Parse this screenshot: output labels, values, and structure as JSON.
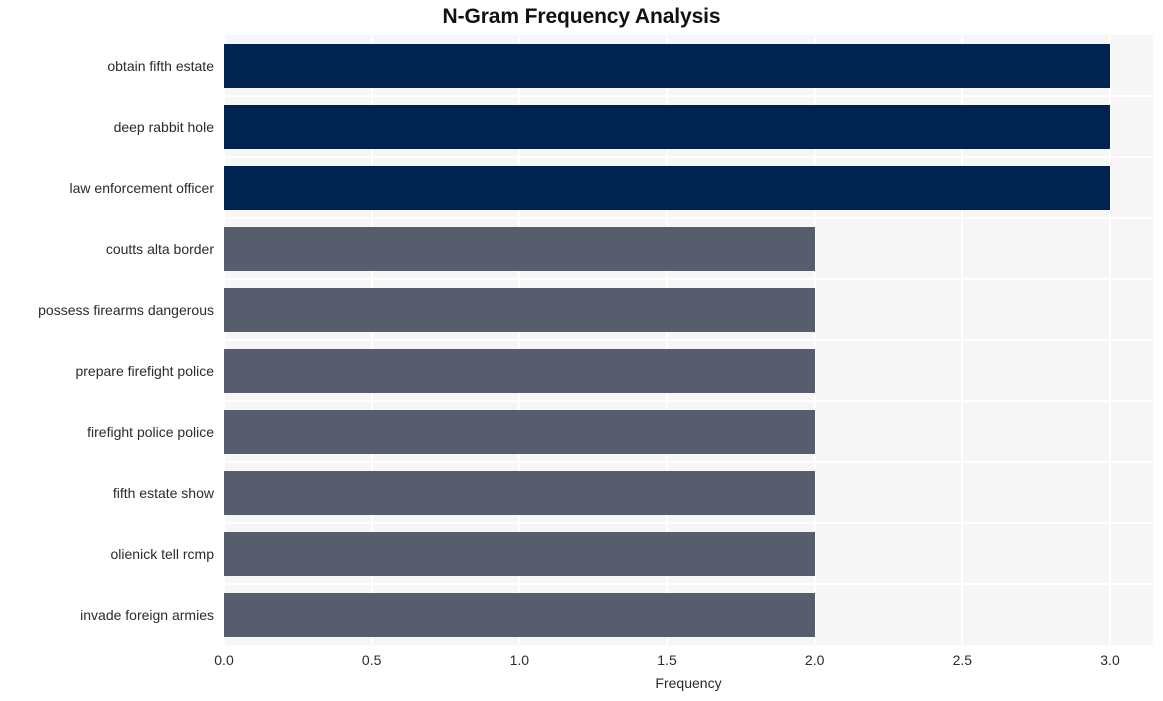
{
  "chart_data": {
    "type": "bar",
    "orientation": "horizontal",
    "title": "N-Gram Frequency Analysis",
    "xlabel": "Frequency",
    "ylabel": "",
    "categories": [
      "obtain fifth estate",
      "deep rabbit hole",
      "law enforcement officer",
      "coutts alta border",
      "possess firearms dangerous",
      "prepare firefight police",
      "firefight police police",
      "fifth estate show",
      "olienick tell rcmp",
      "invade foreign armies"
    ],
    "values": [
      3,
      3,
      3,
      2,
      2,
      2,
      2,
      2,
      2,
      2
    ],
    "xlim": [
      0,
      3
    ],
    "xticks": [
      0,
      0.5,
      1,
      1.5,
      2,
      2.5,
      3
    ],
    "xticklabels": [
      "0.0",
      "0.5",
      "1.0",
      "1.5",
      "2.0",
      "2.5",
      "3.0"
    ],
    "bar_colors": [
      "#00234f",
      "#00234f",
      "#00234f",
      "#585d6e",
      "#585d6e",
      "#585d6e",
      "#585d6e",
      "#585d6e",
      "#585d6e",
      "#585d6e"
    ],
    "grid": true,
    "grid_color": "#ffffff",
    "plot_background": "#f6f6f7",
    "figure_background": "#ffffff",
    "legend": null
  }
}
